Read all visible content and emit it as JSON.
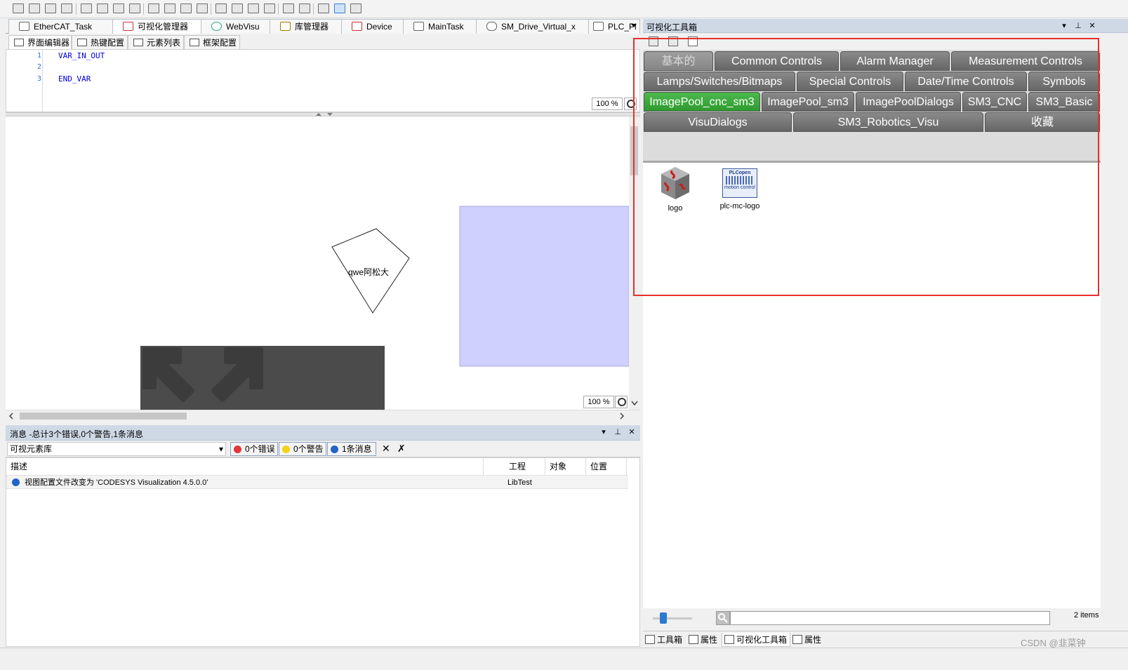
{
  "editor": {
    "tabs": [
      {
        "label": "EtherCAT_Task"
      },
      {
        "label": "可视化管理器"
      },
      {
        "label": "WebVisu"
      },
      {
        "label": "库管理器"
      },
      {
        "label": "Device"
      },
      {
        "label": "MainTask"
      },
      {
        "label": "SM_Drive_Virtual_x"
      },
      {
        "label": "PLC_Pl"
      }
    ],
    "sub_tabs": [
      {
        "label": "界面编辑器"
      },
      {
        "label": "热键配置"
      },
      {
        "label": "元素列表"
      },
      {
        "label": "框架配置"
      }
    ],
    "code_lines": [
      {
        "num": "1",
        "text": "VAR_IN_OUT"
      },
      {
        "num": "2",
        "text": ""
      },
      {
        "num": "3",
        "text": "END_VAR"
      }
    ],
    "code_zoom": "100 %",
    "canvas_zoom": "100 %",
    "canvas_element_text": "qwe阿松大",
    "colors": {
      "rect_fill": "#d0d0ff",
      "dark_panel": "#4b4b4b"
    }
  },
  "messages": {
    "title": "消息 -总计3个错误,0个警告,1条消息",
    "category": "可视元素库",
    "filters": {
      "errors": "0个错误",
      "warnings": "0个警告",
      "infos": "1条消息"
    },
    "columns": [
      "描述",
      "工程",
      "对象",
      "位置"
    ],
    "rows": [
      {
        "desc": "视图配置文件改变为 'CODESYS Visualization 4.5.0.0'",
        "project": "LibTest",
        "object": "",
        "position": ""
      }
    ]
  },
  "toolbox": {
    "title": "可视化工具箱",
    "categories_row1": [
      {
        "label": "基本的"
      },
      {
        "label": "Common Controls"
      },
      {
        "label": "Alarm Manager"
      },
      {
        "label": "Measurement Controls"
      }
    ],
    "categories_row2": [
      {
        "label": "Lamps/Switches/Bitmaps"
      },
      {
        "label": "Special Controls"
      },
      {
        "label": "Date/Time Controls"
      },
      {
        "label": "Symbols"
      }
    ],
    "categories_row3": [
      {
        "label": "ImagePool_cnc_sm3"
      },
      {
        "label": "ImagePool_sm3"
      },
      {
        "label": "ImagePoolDialogs"
      },
      {
        "label": "SM3_CNC"
      },
      {
        "label": "SM3_Basic"
      }
    ],
    "categories_row4": [
      {
        "label": "VisuDialogs"
      },
      {
        "label": "SM3_Robotics_Visu"
      },
      {
        "label": "收藏"
      }
    ],
    "items": [
      {
        "label": "logo",
        "icon": "codesys-cube-icon"
      },
      {
        "label": "plc-mc-logo",
        "icon": "plcopen-motion-control-icon",
        "icon_text_top": "PLCopen",
        "icon_text_bottom": "motion control"
      }
    ],
    "item_count": "2 items",
    "search_placeholder": "",
    "bottom_tabs": [
      {
        "label": "工具箱"
      },
      {
        "label": "属性"
      },
      {
        "label": "可视化工具箱"
      },
      {
        "label": "属性"
      }
    ]
  },
  "watermark": "CSDN @韭菜钟"
}
